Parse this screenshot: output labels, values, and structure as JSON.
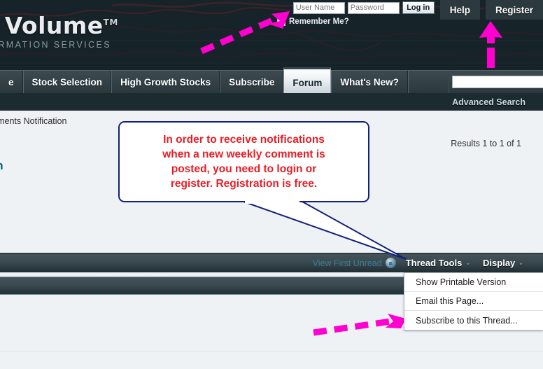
{
  "header": {
    "logo_main": "ive Volume",
    "logo_tm": "TM",
    "logo_sub": "F INFORMATION SERVICES",
    "username_placeholder": "User Name",
    "password_placeholder": "Password",
    "login_label": "Log in",
    "help_label": "Help",
    "register_label": "Register",
    "remember_label": "Remember Me?"
  },
  "nav": {
    "tabs": [
      {
        "label": "e",
        "active": false
      },
      {
        "label": "Stock Selection",
        "active": false
      },
      {
        "label": "High Growth Stocks",
        "active": false
      },
      {
        "label": "Subscribe",
        "active": false
      },
      {
        "label": "Forum",
        "active": true
      },
      {
        "label": "What's New?",
        "active": false
      }
    ],
    "search_value": "",
    "search_icon": "magnifier-icon",
    "advanced_search": "Advanced Search"
  },
  "content": {
    "breadcrumb": "y Comments Notification",
    "page_title": "ation",
    "results": "Results 1 to 1 of 1"
  },
  "tools": {
    "view_first_unread": "View First Unread",
    "unread_icon": "unread-bubble-icon",
    "thread_tools": "Thread Tools",
    "display": "Display",
    "caret": "⌄"
  },
  "menu": {
    "items": [
      "Show Printable Version",
      "Email this Page...",
      "Subscribe to this Thread..."
    ]
  },
  "callout": {
    "text": "In order to receive notifications\nwhen a new weekly comment is\nposted, you need to login or\nregister. Registration is free."
  },
  "colors": {
    "header_bg": "#16242a",
    "nav_bg": "#3d4a50",
    "content_bg": "#eff2f5",
    "callout_border": "#14217a",
    "callout_text": "#ed1c24",
    "annotation_arrow": "#ff00d0",
    "title_color": "#0c5c78",
    "link_color": "#3d7d99"
  },
  "annotations": {
    "arrow_to_username": "dashed-arrow-icon",
    "arrow_to_register": "dashed-up-arrow-icon",
    "arrow_to_subscribe": "dashed-arrow-icon"
  }
}
